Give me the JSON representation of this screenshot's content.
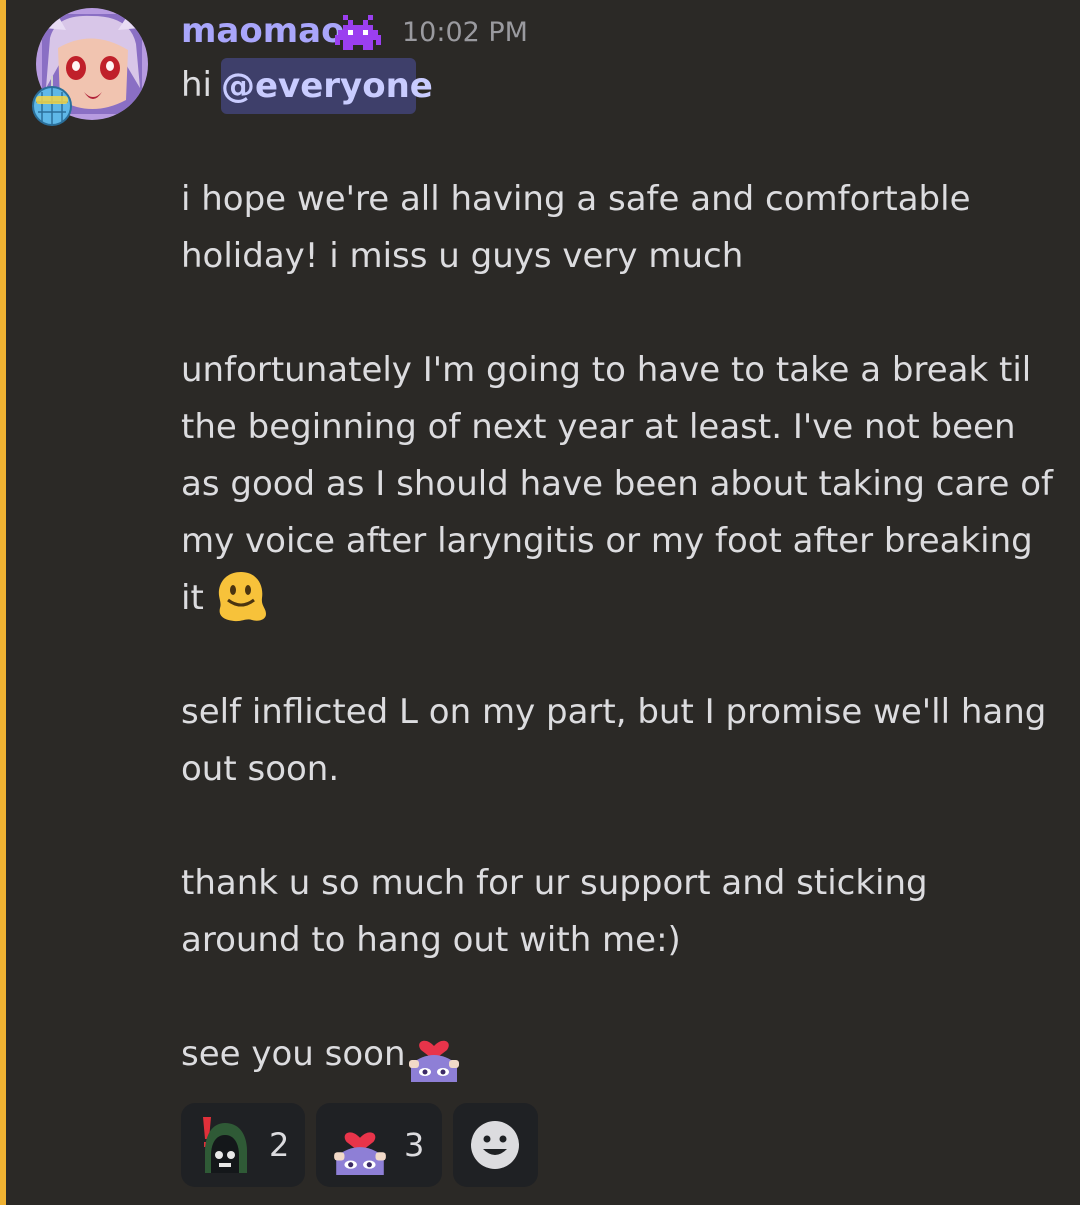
{
  "message": {
    "author": "maomao",
    "author_color": "#a9a6fb",
    "badge_icon": "space-invader-icon",
    "timestamp": "10:02 PM",
    "mention_prefix": "hi",
    "mention": "@everyone",
    "lines": [
      "i hope we're all having a safe and comfortable",
      "holiday! i miss u guys very much",
      "unfortunately I'm going to have to take a break til",
      "the beginning of next year at least. I've not been",
      "as good as I should have been about taking care of",
      "my voice after laryngitis or my foot after breaking",
      "it",
      "self inflicted L on my part, but I promise we'll hang",
      "out soon.",
      "thank u so much for ur support and sticking",
      "around to hang out with me:)",
      "see you soon"
    ],
    "inline_emoji": [
      "melting-face-emoji",
      "heart-peek-emoji"
    ]
  },
  "reactions": [
    {
      "icon": "hooded-alert-emoji",
      "count": "2"
    },
    {
      "icon": "heart-peek-emoji",
      "count": "3"
    },
    {
      "icon": "add-reaction-icon",
      "count": ""
    }
  ],
  "colors": {
    "background": "#2b2926",
    "mention_bar": "#f0b232",
    "mention_bg": "#3e3f6a"
  }
}
